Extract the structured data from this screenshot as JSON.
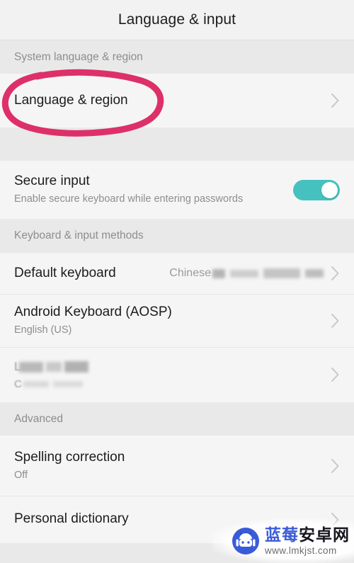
{
  "header": {
    "title": "Language & input"
  },
  "colors": {
    "toggle_on": "#45c1bf",
    "annotation": "#dd3069",
    "row_background": "#f5f5f5",
    "section_background": "#e9e9e9",
    "title_text": "#1c1c1c",
    "secondary_text": "#8e8e8e",
    "chevron": "#c3c3c3",
    "watermark_blue": "#3a5bd9"
  },
  "sections": [
    {
      "id": "system-language-region",
      "header": "System language & region",
      "rows": [
        {
          "id": "language-region",
          "title": "Language & region",
          "subtitle": "",
          "value": "",
          "chevron": "chevron-right-icon",
          "annotated": true
        }
      ]
    },
    {
      "id": "secure-input",
      "header": "",
      "rows": [
        {
          "id": "secure-input",
          "title": "Secure input",
          "subtitle": "Enable secure keyboard while entering passwords",
          "value": "",
          "control": "toggle",
          "toggle_state": "on"
        }
      ]
    },
    {
      "id": "keyboard-input-methods",
      "header": "Keyboard & input methods",
      "rows": [
        {
          "id": "default-keyboard",
          "title": "Default keyboard",
          "subtitle": "",
          "value": "Chinese",
          "value_redacted": true,
          "chevron": "chevron-right-icon"
        },
        {
          "id": "android-keyboard-aosp",
          "title": "Android Keyboard (AOSP)",
          "subtitle": "English (US)",
          "value": "",
          "chevron": "chevron-right-icon"
        },
        {
          "id": "redacted-keyboard",
          "title": "",
          "title_redacted": true,
          "title_hint": "L",
          "subtitle": "",
          "subtitle_redacted": true,
          "subtitle_hint": "C",
          "value": "",
          "chevron": "chevron-right-icon"
        }
      ]
    },
    {
      "id": "advanced",
      "header": "Advanced",
      "rows": [
        {
          "id": "spelling-correction",
          "title": "Spelling correction",
          "subtitle": "Off",
          "value": "",
          "chevron": "chevron-right-icon"
        },
        {
          "id": "personal-dictionary",
          "title": "Personal dictionary",
          "subtitle": "",
          "value": "",
          "chevron": "chevron-right-icon"
        }
      ]
    }
  ],
  "annotation": {
    "shape": "hand-drawn-oval",
    "target": "Language & region"
  },
  "watermark": {
    "brand_blue": "蓝莓",
    "brand_dark": "安卓网",
    "url": "www.lmkjst.com",
    "logo": "android-robot-icon"
  }
}
